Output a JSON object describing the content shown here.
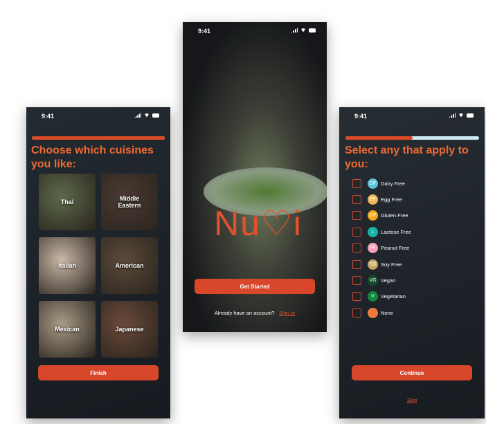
{
  "status_time": "9:41",
  "cuisines": {
    "title": "Choose which cuisines you like:",
    "progress": 1.0,
    "items": [
      {
        "label": "Thai",
        "bg": "#5d6a4a"
      },
      {
        "label": "Middle Eastern",
        "bg": "#4a3a32"
      },
      {
        "label": "Italian",
        "bg": "#c9b8a6"
      },
      {
        "label": "American",
        "bg": "#5b4a3a"
      },
      {
        "label": "Mexican",
        "bg": "#a89a86"
      },
      {
        "label": "Japanese",
        "bg": "#6b4a3a"
      }
    ],
    "finish_label": "Finish"
  },
  "welcome": {
    "logo": "Nu♡i",
    "get_started_label": "Get Started",
    "account_prompt": "Already have an account?",
    "sign_in_label": "Sign In"
  },
  "diet": {
    "title": "Select any that apply to you:",
    "progress": 0.5,
    "items": [
      {
        "abbr": "DF",
        "label": "Dairy Free",
        "color": "#5fc3d6"
      },
      {
        "abbr": "EF",
        "label": "Egg Free",
        "color": "#f0b55a"
      },
      {
        "abbr": "GF",
        "label": "Gluten Free",
        "color": "#f6a81c"
      },
      {
        "abbr": "L",
        "label": "Lactose Free",
        "color": "#17b3a6"
      },
      {
        "abbr": "PF",
        "label": "Peanut Free",
        "color": "#f5a0b8"
      },
      {
        "abbr": "SO",
        "label": "Soy Free",
        "color": "#c5a466"
      },
      {
        "abbr": "VG",
        "label": "Vegan",
        "color": "#0e4f2a"
      },
      {
        "abbr": "V",
        "label": "Vegetarian",
        "color": "#0f8a3a"
      },
      {
        "abbr": "",
        "label": "None",
        "color": "#ee7a40"
      }
    ],
    "continue_label": "Continue",
    "skip_label": "Skip"
  },
  "colors": {
    "accent": "#d9472a",
    "title": "#ee6a32"
  }
}
